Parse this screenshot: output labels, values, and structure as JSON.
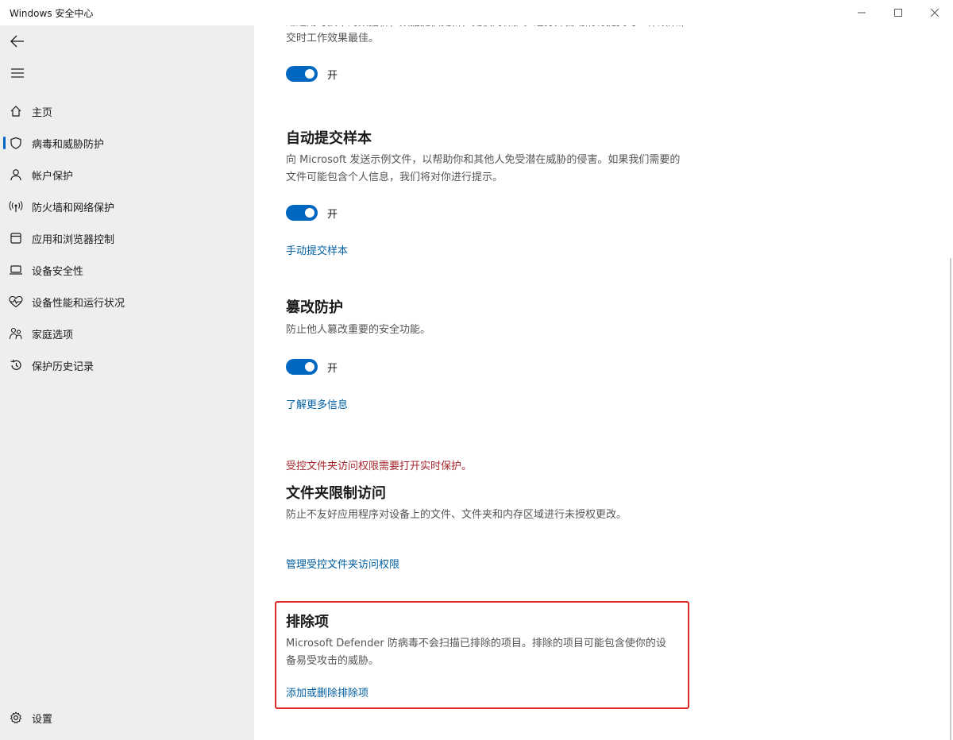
{
  "window": {
    "title": "Windows 安全中心"
  },
  "sidebar": {
    "items": [
      {
        "label": "主页",
        "icon": "home-icon"
      },
      {
        "label": "病毒和威胁防护",
        "icon": "shield-icon"
      },
      {
        "label": "帐户保护",
        "icon": "person-icon"
      },
      {
        "label": "防火墙和网络保护",
        "icon": "antenna-icon"
      },
      {
        "label": "应用和浏览器控制",
        "icon": "app-window-icon"
      },
      {
        "label": "设备安全性",
        "icon": "laptop-icon"
      },
      {
        "label": "设备性能和运行状况",
        "icon": "heart-pulse-icon"
      },
      {
        "label": "家庭选项",
        "icon": "family-icon"
      },
      {
        "label": "保护历史记录",
        "icon": "history-icon"
      }
    ],
    "settings_label": "设置"
  },
  "content": {
    "top_clipped_text": "过通用可技术的数据析，数据提供更新，更快的保护。适打开自动消有提交时工作效果最佳。",
    "top_clipped_text_line2": "交时工作效果最佳。",
    "cloud": {
      "toggle_label": "开"
    },
    "sample": {
      "title": "自动提交样本",
      "desc": "向 Microsoft 发送示例文件，以帮助你和其他人免受潜在威胁的侵害。如果我们需要的文件可能包含个人信息，我们将对你进行提示。",
      "toggle_label": "开",
      "link": "手动提交样本"
    },
    "tamper": {
      "title": "篡改防护",
      "desc": "防止他人篡改重要的安全功能。",
      "toggle_label": "开",
      "link": "了解更多信息"
    },
    "folder": {
      "warning": "受控文件夹访问权限需要打开实时保护。",
      "title": "文件夹限制访问",
      "desc": "防止不友好应用程序对设备上的文件、文件夹和内存区域进行未授权更改。",
      "link": "管理受控文件夹访问权限"
    },
    "exclusions": {
      "title": "排除项",
      "desc": "Microsoft Defender 防病毒不会扫描已排除的项目。排除的项目可能包含使你的设备易受攻击的威胁。",
      "link": "添加或删除排除项"
    }
  },
  "colors": {
    "accent": "#0067c0",
    "link": "#005fa3",
    "warning": "#a4262c",
    "highlight": "#e02a2a"
  }
}
